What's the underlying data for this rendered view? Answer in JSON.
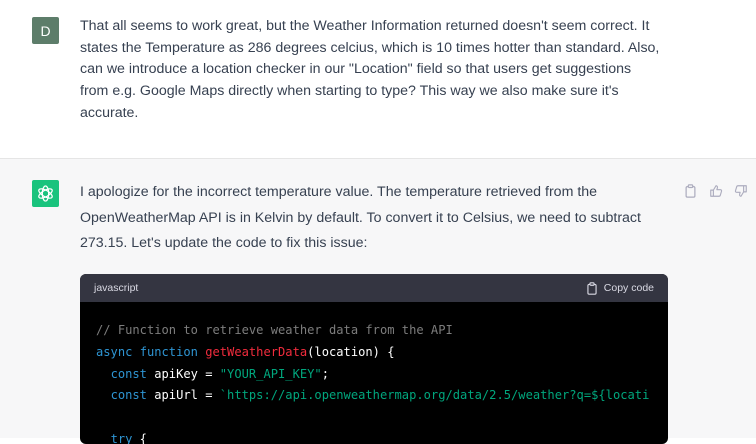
{
  "user_message": {
    "avatar_initial": "D",
    "lines": [
      "That all seems to work great, but the Weather Information returned doesn't seem correct. It",
      "states the Temperature as 286 degrees celcius, which is 10 times hotter than standard. Also,",
      "can we introduce a location checker in our \"Location\" field so that users get suggestions",
      "from e.g. Google Maps directly when starting to type? This way we also make sure it's",
      "accurate."
    ]
  },
  "assistant_message": {
    "lines": [
      "I apologize for the incorrect temperature value. The temperature retrieved from the",
      "OpenWeatherMap API is in Kelvin by default. To convert it to Celsius, we need to subtract",
      "273.15. Let's update the code to fix this issue:"
    ],
    "code_block": {
      "language": "javascript",
      "copy_label": "Copy code",
      "comment": "// Function to retrieve weather data from the API",
      "kw_async": "async",
      "kw_function": "function",
      "fn_name": "getWeatherData",
      "fn_params": "(location) {",
      "kw_const1": "const",
      "var_apikey": " apiKey = ",
      "str_apikey": "\"YOUR_API_KEY\"",
      "semicolon": ";",
      "kw_const2": "const",
      "var_apiurl": " apiUrl = ",
      "str_apiurl": "`https://api.openweathermap.org/data/2.5/weather?q=${locati",
      "kw_try": "try",
      "try_brace": " {"
    }
  },
  "colors": {
    "user_avatar": "#5d7d6a",
    "assistant_avatar": "#19c37d",
    "code_bg": "#000000",
    "code_header_bg": "#343541"
  },
  "icons": [
    "openai-logo-icon",
    "clipboard-icon",
    "thumbs-up-icon",
    "thumbs-down-icon"
  ]
}
